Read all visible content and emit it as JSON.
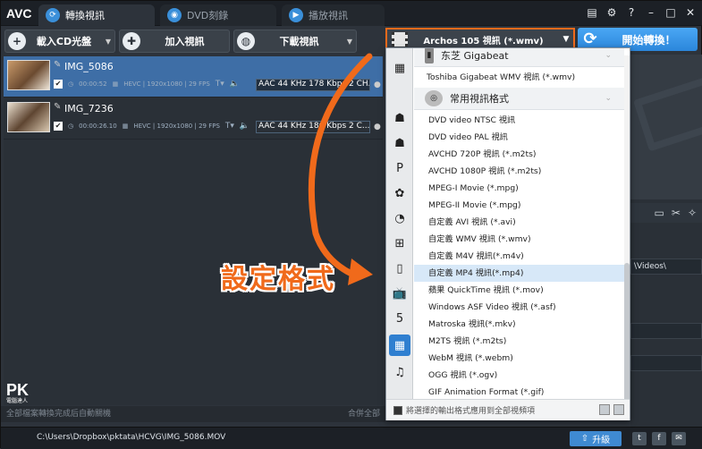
{
  "app": {
    "logo": "AVC"
  },
  "tabs": [
    {
      "label": "轉換視訊"
    },
    {
      "label": "DVD刻錄"
    },
    {
      "label": "播放視訊"
    }
  ],
  "toolbar": {
    "load_cd": "載入CD光盤",
    "add_video": "加入視訊",
    "download_video": "下載視訊"
  },
  "format_select": {
    "value": "Archos 105 視訊 (*.wmv)"
  },
  "convert_label": "開始轉換！",
  "files": [
    {
      "name": "IMG_5086",
      "duration": "00:00:52",
      "video_info": "HEVC | 1920x1080 | 29 FPS",
      "audio": "AAC 44 KHz 178 Kbps 2 CH..."
    },
    {
      "name": "IMG_7236",
      "duration": "00:00:26.10",
      "video_info": "HEVC | 1920x1080 | 29 FPS",
      "audio": "AAC 44 KHz 186 Kbps 2 C..."
    }
  ],
  "dropdown": {
    "groups": [
      {
        "label": "东芝 Gigabeat"
      },
      {
        "label": "常用視訊格式"
      }
    ],
    "toshiba_item": "Toshiba Gigabeat WMV 視訊 (*.wmv)",
    "items": [
      "DVD video NTSC 視訊",
      "DVD video PAL 視訊",
      "AVCHD 720P 視訊 (*.m2ts)",
      "AVCHD 1080P 視訊 (*.m2ts)",
      "MPEG-I Movie (*.mpg)",
      "MPEG-II Movie (*.mpg)",
      "自定義 AVI 視訊 (*.avi)",
      "自定義 WMV 視訊 (*.wmv)",
      "自定義 M4V 視訊(*.m4v)",
      "自定義 MP4 視訊(*.mp4)",
      "蘋果 QuickTime 視訊 (*.mov)",
      "Windows ASF Video 視訊 (*.asf)",
      "Matroska 視訊(*.mkv)",
      "M2TS 視訊 (*.m2ts)",
      "WebM 視訊 (*.webm)",
      "OGG 視訊 (*.ogv)",
      "GIF Animation Format (*.gif)"
    ],
    "footer": "將選擇的輸出格式應用到全部視頻項"
  },
  "annotation": "設定格式",
  "bottom": {
    "left": "全部檔案轉換完成后自動關機",
    "right": "合併全部"
  },
  "right_panel": {
    "path": "\\Videos\\"
  },
  "status": {
    "path": "C:\\Users\\Dropbox\\pktata\\HCVG\\IMG_5086.MOV",
    "upgrade": "升級"
  },
  "watermark": {
    "brand": "PK",
    "sub": "電腦達人"
  }
}
